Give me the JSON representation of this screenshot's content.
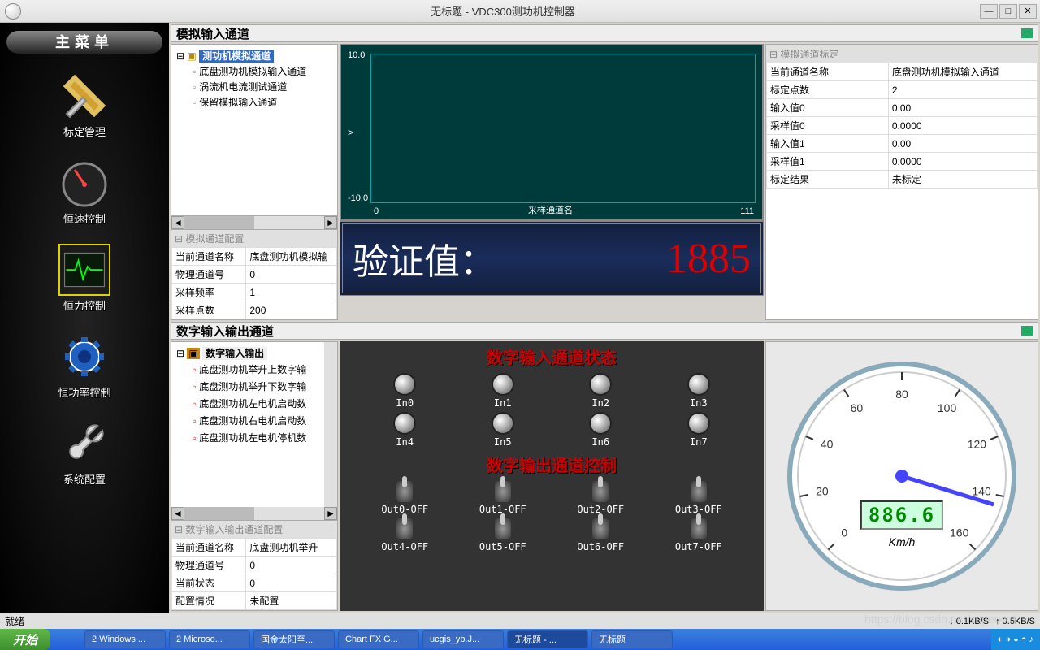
{
  "window": {
    "title": "无标题 - VDC300测功机控制器"
  },
  "sidebar": {
    "header": "主菜单",
    "items": [
      {
        "label": "标定管理",
        "icon": "wrench"
      },
      {
        "label": "恒速控制",
        "icon": "gauge"
      },
      {
        "label": "恒力控制",
        "icon": "ecg",
        "active": true
      },
      {
        "label": "恒功率控制",
        "icon": "gear"
      },
      {
        "label": "系统配置",
        "icon": "spanner"
      }
    ]
  },
  "analog_panel": {
    "title": "模拟输入通道",
    "tree_root": "测功机模拟通道",
    "tree_children": [
      "底盘测功机模拟输入通道",
      "涡流机电流测试通道",
      "保留模拟输入通道"
    ],
    "config_header": "模拟通道配置",
    "config_rows": [
      {
        "k": "当前通道名称",
        "v": "底盘测功机模拟输"
      },
      {
        "k": "物理通道号",
        "v": "0"
      },
      {
        "k": "采样频率",
        "v": "1"
      },
      {
        "k": "采样点数",
        "v": "200"
      }
    ],
    "cal_header": "模拟通道标定",
    "cal_rows": [
      {
        "k": "当前通道名称",
        "v": "底盘测功机模拟输入通道"
      },
      {
        "k": "标定点数",
        "v": "2"
      },
      {
        "k": "输入值0",
        "v": "0.00"
      },
      {
        "k": "采样值0",
        "v": "0.0000"
      },
      {
        "k": "输入值1",
        "v": "0.00"
      },
      {
        "k": "采样值1",
        "v": "0.0000"
      },
      {
        "k": "标定结果",
        "v": "未标定"
      }
    ]
  },
  "chart_data": {
    "type": "line",
    "title": "",
    "xlabel": "采样通道名:",
    "ylabel": "",
    "ylim": [
      -10.0,
      10.0
    ],
    "xlim": [
      0,
      111
    ],
    "series": [
      {
        "name": "",
        "values": []
      }
    ]
  },
  "chart_labels": {
    "y_top": "10.0",
    "y_bot": "-10.0",
    "x_left": "0",
    "x_right": "111",
    "x_label": "采样通道名:"
  },
  "verify": {
    "label": "验证值：",
    "value": "1885"
  },
  "digital_panel": {
    "title": "数字输入输出通道",
    "tree_root": "数字输入输出",
    "tree_children": [
      "底盘测功机举升上数字输",
      "底盘测功机举升下数字输",
      "底盘测功机左电机启动数",
      "底盘测功机右电机启动数",
      "底盘测功机左电机停机数"
    ],
    "config_header": "数字输入输出通道配置",
    "config_rows": [
      {
        "k": "当前通道名称",
        "v": "底盘测功机举升"
      },
      {
        "k": "物理通道号",
        "v": "0"
      },
      {
        "k": "当前状态",
        "v": "0"
      },
      {
        "k": "配置情况",
        "v": "未配置"
      }
    ],
    "input_title": "数字输入通道状态",
    "output_title": "数字输出通道控制",
    "inputs": [
      "In0",
      "In1",
      "In2",
      "In3",
      "In4",
      "In5",
      "In6",
      "In7"
    ],
    "outputs": [
      "Out0-OFF",
      "Out1-OFF",
      "Out2-OFF",
      "Out3-OFF",
      "Out4-OFF",
      "Out5-OFF",
      "Out6-OFF",
      "Out7-OFF"
    ]
  },
  "gauge": {
    "value": "886.6",
    "unit": "Km/h",
    "ticks": [
      "0",
      "20",
      "40",
      "60",
      "80",
      "100",
      "120",
      "140",
      "160"
    ]
  },
  "statusbar": {
    "ready": "就绪",
    "down": "0.1KB/S",
    "up": "0.5KB/S"
  },
  "taskbar": {
    "start": "开始",
    "items": [
      "2 Windows ...",
      "2 Microso...",
      "国金太阳至...",
      "Chart FX G...",
      "ucgis_yb.J...",
      "无标题 - ...",
      "无标题"
    ]
  },
  "watermark": "https://blog.csdn.net/superxxd"
}
